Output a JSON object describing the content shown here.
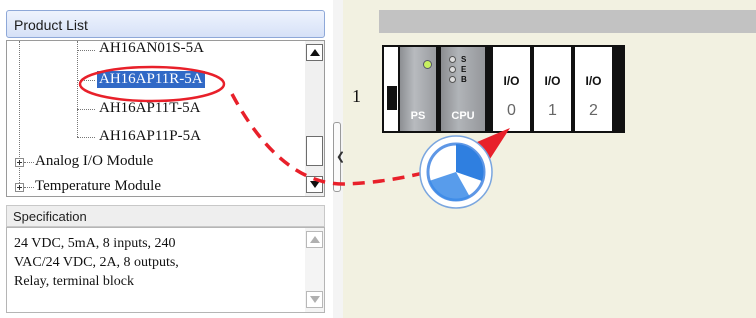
{
  "product_list": {
    "header": "Product List",
    "tree_items": [
      {
        "label": "AH16AN01S-5A"
      },
      {
        "label": "AH16AP11R-5A",
        "selected": true
      },
      {
        "label": "AH16AP11T-5A"
      },
      {
        "label": "AH16AP11P-5A"
      },
      {
        "label": "Analog I/O Module",
        "expandable": true
      },
      {
        "label": "Temperature Module",
        "expandable": true
      }
    ]
  },
  "specification": {
    "header": "Specification",
    "lines": [
      "24 VDC, 5mA, 8 inputs, 240",
      "VAC/24 VDC, 2A, 8 outputs,",
      "Relay, terminal block"
    ]
  },
  "rack": {
    "row_number": "1",
    "modules": [
      {
        "label": "PS"
      },
      {
        "label": "CPU",
        "leds": [
          "S",
          "E",
          "B"
        ]
      },
      {
        "label": "I/O",
        "slot": "0"
      },
      {
        "label": "I/O",
        "slot": "1"
      },
      {
        "label": "I/O",
        "slot": "2"
      }
    ]
  },
  "colors": {
    "selection": "#3169c6",
    "annotation": "#e8202a",
    "workspace_bg": "#f2f1e1",
    "drag_cursor": "#2f7fe0"
  },
  "icons": [
    "scroll-up-icon",
    "scroll-down-icon",
    "expand-plus-icon",
    "collapse-splitter-icon",
    "drag-cursor-icon"
  ]
}
